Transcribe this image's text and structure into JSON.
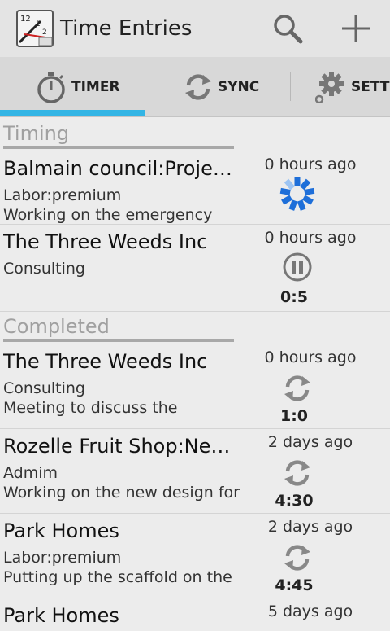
{
  "actionbar": {
    "title": "Time Entries",
    "app_icon": "clock-sheet-icon",
    "search_icon": "search-icon",
    "add_icon": "plus-icon"
  },
  "tabs": [
    {
      "label": "TIMER",
      "icon": "stopwatch-icon",
      "selected": true
    },
    {
      "label": "SYNC",
      "icon": "sync-icon",
      "selected": false
    },
    {
      "label": "SETTI",
      "icon": "gear-icon",
      "selected": false
    }
  ],
  "colors": {
    "accent": "#33b5e5",
    "spinner": "#1e6fd9",
    "section_text": "#a0a0a0"
  },
  "sections": {
    "timing": "Timing",
    "completed": "Completed"
  },
  "entries": [
    {
      "client": "Balmain council:Proje…",
      "task": "Labor:premium",
      "note": "Working on the emergency",
      "ago": "0 hours ago",
      "status": "spinner-icon",
      "duration": ""
    },
    {
      "client": "The Three Weeds Inc",
      "task": "Consulting",
      "note": "",
      "ago": "0 hours ago",
      "status": "pause-icon",
      "duration": "0:5"
    },
    {
      "client": "The Three Weeds Inc",
      "task": "Consulting",
      "note": "Meeting to discuss the",
      "ago": "0 hours ago",
      "status": "sync-icon",
      "duration": "1:0"
    },
    {
      "client": "Rozelle Fruit Shop:Ne…",
      "task": "Admim",
      "note": "Working on the new design for",
      "ago": "2 days ago",
      "status": "sync-icon",
      "duration": "4:30"
    },
    {
      "client": "Park Homes",
      "task": "Labor:premium",
      "note": "Putting up the scaffold on the",
      "ago": "2 days ago",
      "status": "sync-icon",
      "duration": "4:45"
    },
    {
      "client": "Park Homes",
      "task": "",
      "note": "",
      "ago": "5 days ago",
      "status": "",
      "duration": ""
    }
  ]
}
